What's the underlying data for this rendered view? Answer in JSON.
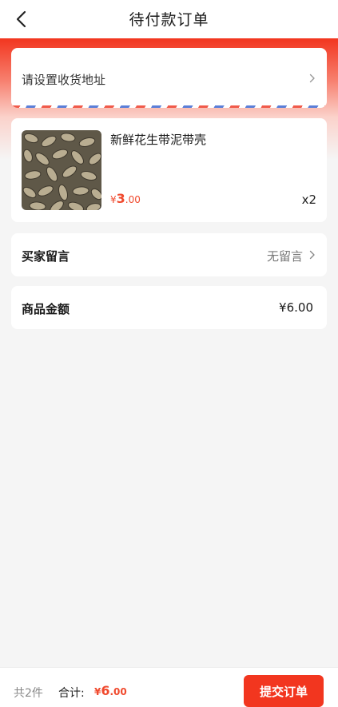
{
  "header": {
    "title": "待付款订单",
    "back_icon": "chevron-left-icon"
  },
  "address": {
    "label": "请设置收货地址"
  },
  "product": {
    "name": "新鲜花生带泥带壳",
    "price_symbol": "¥",
    "price_int": "3",
    "price_dec": ".00",
    "quantity": "x2"
  },
  "message": {
    "label": "买家留言",
    "value": "无留言"
  },
  "amount": {
    "label": "商品金额",
    "value": "¥6.00"
  },
  "footer": {
    "count": "共2件",
    "total_label": "合计:",
    "total_symbol": "¥",
    "total_int": "6",
    "total_dec": ".00",
    "submit_label": "提交订单"
  },
  "colors": {
    "accent": "#f2361f",
    "price": "#f04a2e",
    "background": "#f5f5f5"
  }
}
